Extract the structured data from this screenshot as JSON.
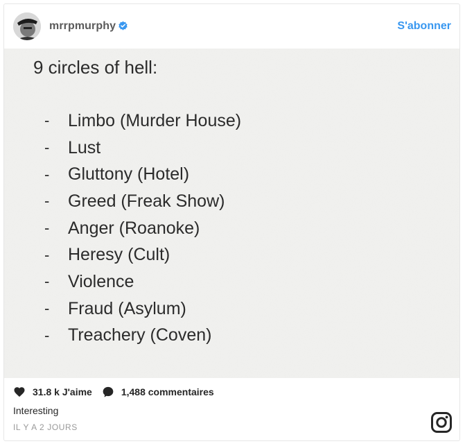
{
  "header": {
    "username": "mrrpmurphy",
    "follow_label": "S'abonner"
  },
  "post": {
    "title": "9 circles of hell:",
    "items": [
      "Limbo (Murder House)",
      "Lust",
      "Gluttony (Hotel)",
      "Greed (Freak Show)",
      "Anger (Roanoke)",
      "Heresy (Cult)",
      "Violence",
      "Fraud (Asylum)",
      "Treachery (Coven)"
    ],
    "dash": "-"
  },
  "footer": {
    "likes": "31.8 k J'aime",
    "comments": "1,488 commentaires",
    "caption": "Interesting",
    "timestamp": "IL Y A 2 JOURS"
  },
  "colors": {
    "accent": "#3897f0",
    "text": "#262626",
    "muted": "#999999",
    "paper": "#f3f3f1"
  },
  "icons": {
    "verified": "verified-badge-icon",
    "like": "heart-icon",
    "comment": "comment-bubble-icon",
    "brand": "instagram-icon"
  }
}
